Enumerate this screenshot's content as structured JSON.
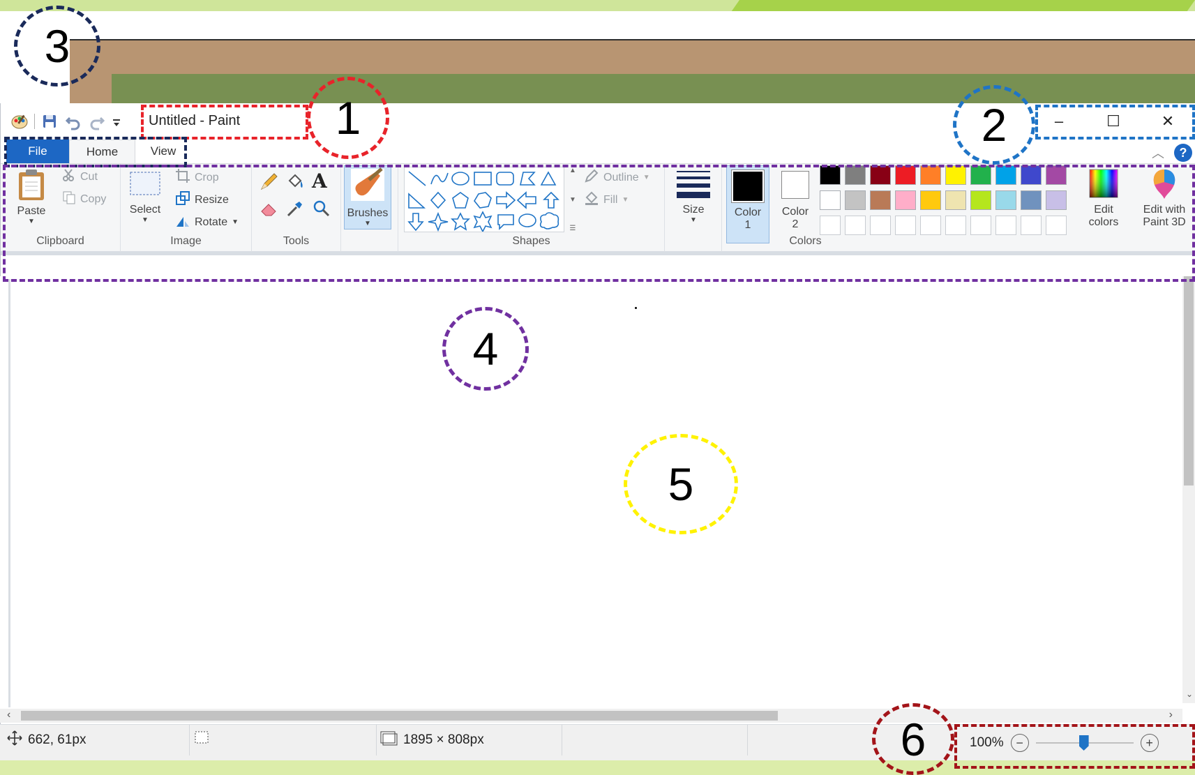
{
  "window": {
    "title": "Untitled - Paint"
  },
  "quick_access": {
    "icons": [
      "paint-app-icon",
      "save-icon",
      "undo-icon",
      "redo-icon",
      "customize-qat-icon"
    ]
  },
  "window_controls": {
    "minimize": "–",
    "maximize": "☐",
    "close": "✕"
  },
  "tabs": [
    "File",
    "Home",
    "View"
  ],
  "help_label": "?",
  "ribbon": {
    "clipboard": {
      "label": "Clipboard",
      "paste": "Paste",
      "cut": "Cut",
      "copy": "Copy"
    },
    "image": {
      "label": "Image",
      "select": "Select",
      "crop": "Crop",
      "resize": "Resize",
      "rotate": "Rotate"
    },
    "tools": {
      "label": "Tools"
    },
    "brushes": {
      "label": "Brushes"
    },
    "shapes": {
      "label": "Shapes",
      "outline": "Outline",
      "fill": "Fill"
    },
    "size": {
      "label": "Size"
    },
    "colors": {
      "label": "Colors",
      "color1_label": "Color",
      "color1_num": "1",
      "color2_label": "Color",
      "color2_num": "2",
      "edit_colors_line1": "Edit",
      "edit_colors_line2": "colors",
      "paint3d_line1": "Edit with",
      "paint3d_line2": "Paint 3D",
      "palette_row1": [
        "#000000",
        "#7f7f7f",
        "#880015",
        "#ed1c24",
        "#ff7f27",
        "#fff200",
        "#22b14c",
        "#00a2e8",
        "#3f48cc",
        "#a349a4"
      ],
      "palette_row2": [
        "#ffffff",
        "#c3c3c3",
        "#b97a57",
        "#ffaec9",
        "#ffc90e",
        "#efe4b0",
        "#b5e61d",
        "#99d9ea",
        "#7092be",
        "#c8bfe7"
      ]
    }
  },
  "status": {
    "cursor_pos": "662, 61px",
    "canvas_size": "1895 × 808px",
    "zoom": "100%"
  },
  "annotations": {
    "n1": "1",
    "n2": "2",
    "n3": "3",
    "n4": "4",
    "n5": "5",
    "n6": "6",
    "colors": {
      "n1": "#e8232a",
      "n2": "#1f74c6",
      "n3": "#1a2a5a",
      "n4": "#7030a0",
      "n5": "#fff200",
      "n6": "#a31419"
    }
  }
}
